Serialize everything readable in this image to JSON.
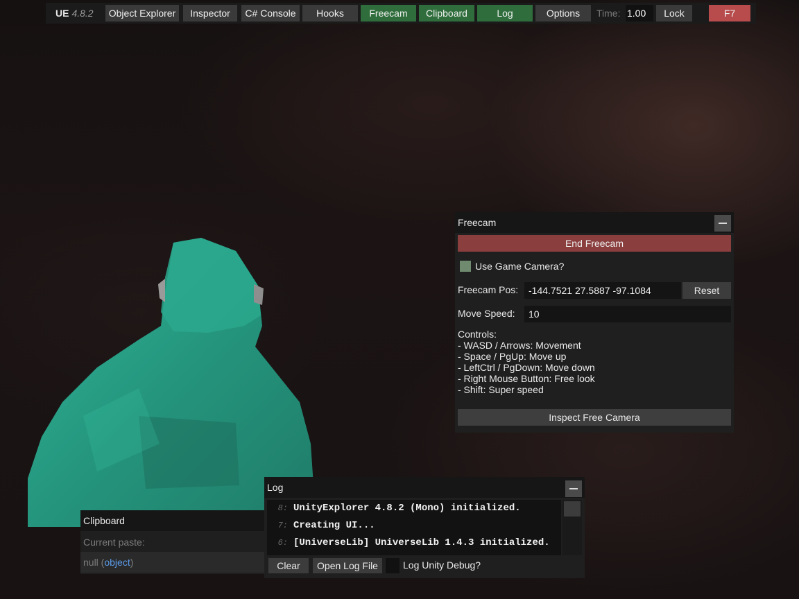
{
  "topbar": {
    "app": "UE",
    "version": "4.8.2",
    "tabs": [
      {
        "label": "Object Explorer",
        "active": false
      },
      {
        "label": "Inspector",
        "active": false
      },
      {
        "label": "C# Console",
        "active": false
      },
      {
        "label": "Hooks",
        "active": false
      },
      {
        "label": "Freecam",
        "active": true
      },
      {
        "label": "Clipboard",
        "active": true
      },
      {
        "label": "Log",
        "active": true
      },
      {
        "label": "Options",
        "active": false
      }
    ],
    "time_label": "Time:",
    "time_value": "1.00",
    "lock_label": "Lock",
    "hotkey_label": "F7"
  },
  "freecam": {
    "title": "Freecam",
    "end_label": "End Freecam",
    "use_game_camera_label": "Use Game Camera?",
    "pos_label": "Freecam Pos:",
    "pos_value": "-144.7521 27.5887 -97.1084",
    "reset_label": "Reset",
    "speed_label": "Move Speed:",
    "speed_value": "10",
    "controls": [
      "Controls:",
      "- WASD / Arrows: Movement",
      "- Space / PgUp: Move up",
      "- LeftCtrl / PgDown: Move down",
      "- Right Mouse Button: Free look",
      "- Shift: Super speed"
    ],
    "inspect_label": "Inspect Free Camera"
  },
  "clipboard": {
    "title": "Clipboard",
    "current_label": "Current paste:",
    "value_null": "null",
    "value_open": " (",
    "value_type": "object",
    "value_close": ")"
  },
  "log": {
    "title": "Log",
    "lines": [
      {
        "num": "8:",
        "text": "UnityExplorer 4.8.2 (Mono) initialized."
      },
      {
        "num": "7:",
        "text": "Creating UI..."
      },
      {
        "num": "6:",
        "text": "[UniverseLib] UniverseLib 1.4.3 initialized."
      }
    ],
    "clear_label": "Clear",
    "open_label": "Open Log File",
    "debug_label": "Log Unity Debug?"
  },
  "colors": {
    "active_tab": "#2f6e3c",
    "hotkey": "#b84b4b",
    "end_button": "#8a3e3e",
    "figure": "#2a9e86"
  }
}
